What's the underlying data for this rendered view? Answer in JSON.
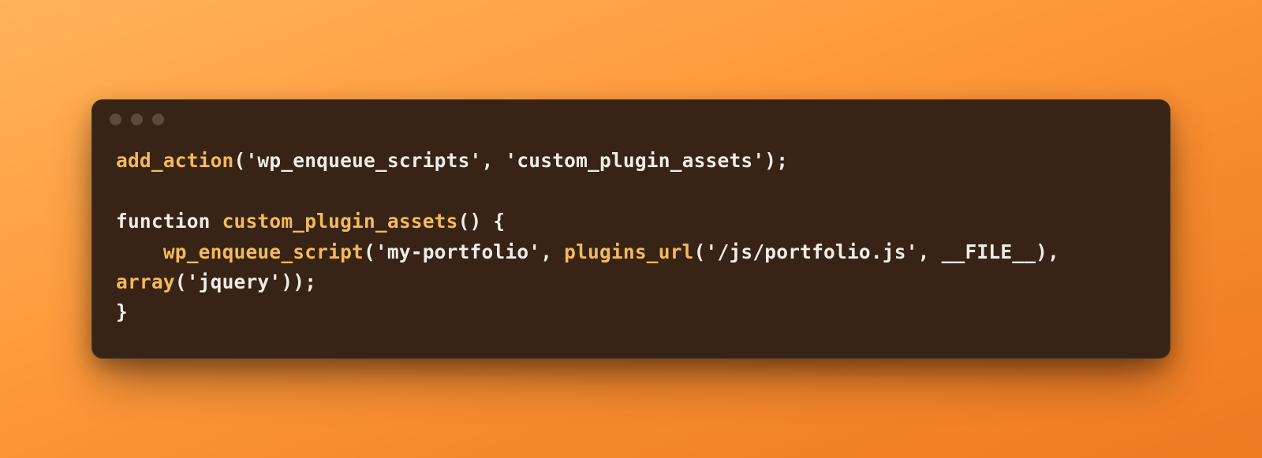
{
  "colors": {
    "window_bg": "#372417",
    "text": "#f2ece5",
    "accent": "#f5b95a",
    "traffic_dot": "#5c4a3d",
    "bg_gradient_from": "#ffb35a",
    "bg_gradient_to": "#ee7a22"
  },
  "titlebar": {
    "dots": 3
  },
  "code": {
    "line1": {
      "fn1": "add_action",
      "p1": "(",
      "str1": "'wp_enqueue_scripts'",
      "sep1": ", ",
      "str2": "'custom_plugin_assets'",
      "p2": ");"
    },
    "blank": "",
    "line3": {
      "kw": "function",
      "sp": " ",
      "name": "custom_plugin_assets",
      "rest": "() {"
    },
    "line4": {
      "indent": "    ",
      "fn1": "wp_enqueue_script",
      "p1": "(",
      "str1": "'my-portfolio'",
      "sep1": ", ",
      "fn2": "plugins_url",
      "p2": "(",
      "str2": "'/js/portfolio.js'",
      "sep2": ", ",
      "const": "__FILE__",
      "p3": "), "
    },
    "line5": {
      "fn1": "array",
      "p1": "(",
      "str1": "'jquery'",
      "p2": "));"
    },
    "line6": {
      "brace": "}"
    }
  }
}
